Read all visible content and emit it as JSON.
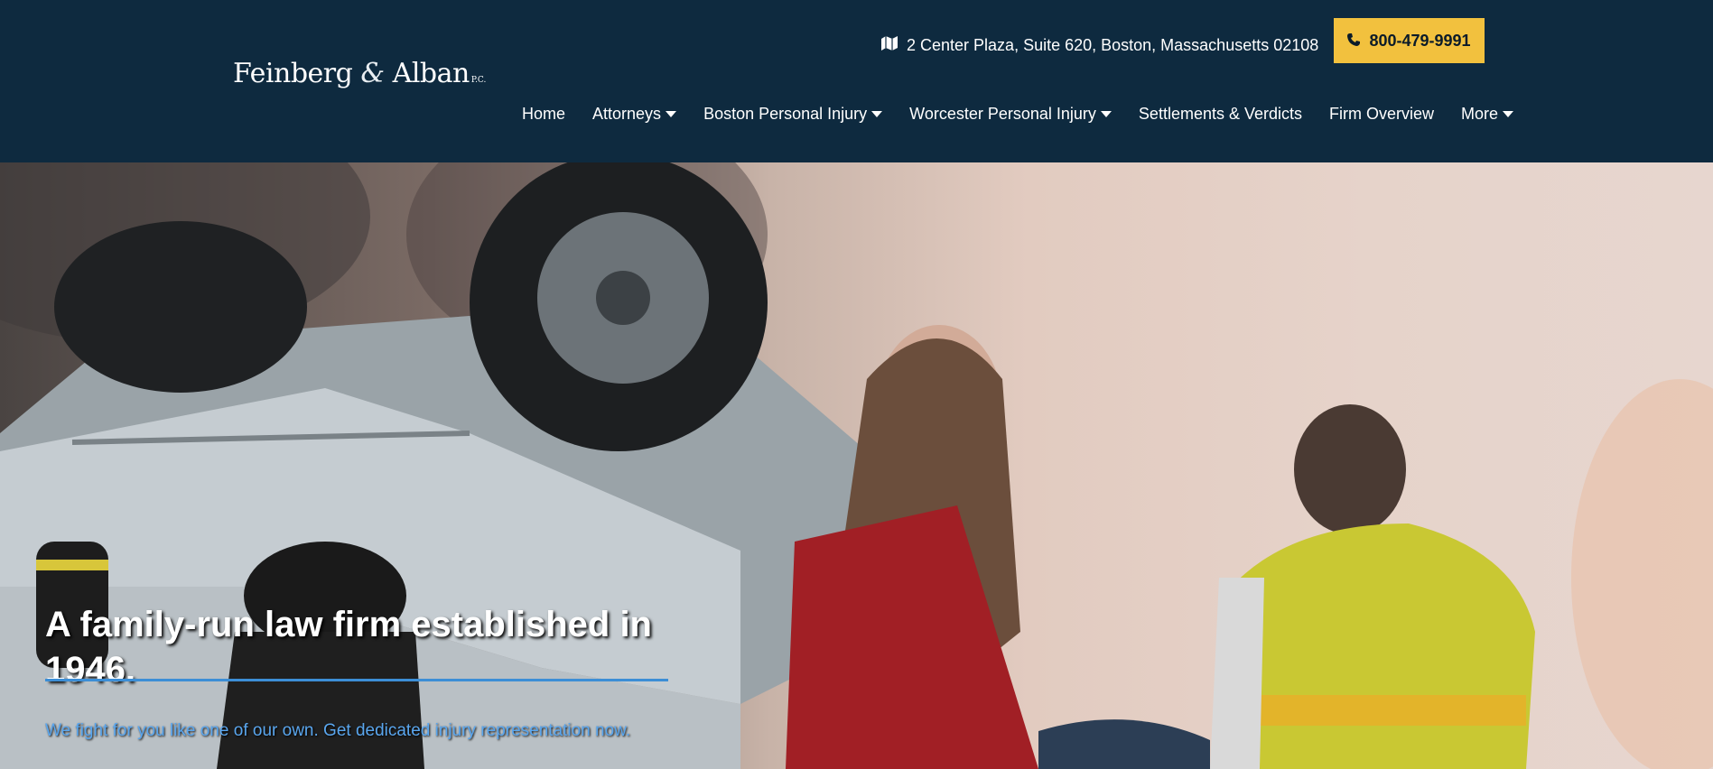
{
  "header": {
    "logo": {
      "name_part1": "Feinberg",
      "ampersand": "&",
      "name_part2": "Alban",
      "suffix": "P.C."
    },
    "address": {
      "icon": "map-icon",
      "text": "2 Center Plaza, Suite 620, Boston, Massachusetts 02108"
    },
    "phone": {
      "icon": "phone-icon",
      "label": "800-479-9991",
      "bg_color": "#f2c13e"
    },
    "nav": {
      "items": [
        {
          "label": "Home",
          "has_dropdown": false
        },
        {
          "label": "Attorneys",
          "has_dropdown": true
        },
        {
          "label": "Boston Personal Injury",
          "has_dropdown": true
        },
        {
          "label": "Worcester Personal Injury",
          "has_dropdown": true
        },
        {
          "label": "Settlements & Verdicts",
          "has_dropdown": false
        },
        {
          "label": "Firm Overview",
          "has_dropdown": false
        },
        {
          "label": "More",
          "has_dropdown": true
        }
      ]
    },
    "bg_color": "#0e2a3f"
  },
  "hero": {
    "headline": "A family-run law firm established in 1946.",
    "tagline": "We fight for you like one of our own. Get dedicated injury representation now.",
    "accent_color": "#3c8ed6"
  }
}
